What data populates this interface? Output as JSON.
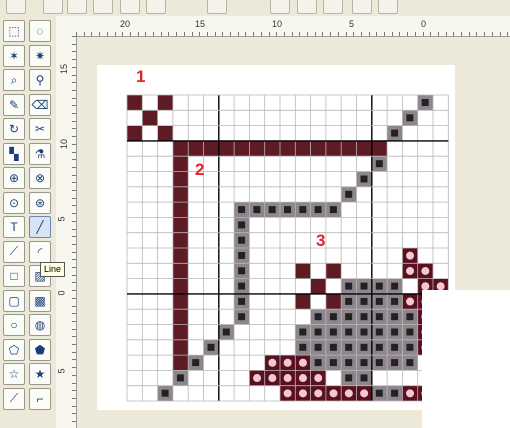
{
  "toolbar": {
    "icons": [
      "zigzag-icon",
      "new-page-icon",
      "open-icon",
      "open-folder-icon",
      "save-icon",
      "print-icon",
      "paste-special-icon",
      "cut-icon",
      "copy-icon",
      "paste-icon",
      "select-icon",
      "erase-icon"
    ]
  },
  "ruler": {
    "h_labels": [
      "20",
      "15",
      "10",
      "5",
      "0"
    ],
    "v_labels": [
      "15",
      "10",
      "5",
      "0",
      "5"
    ]
  },
  "tooltip": {
    "text": "Line"
  },
  "annotations": [
    {
      "id": "1",
      "text": "1"
    },
    {
      "id": "2",
      "text": "2"
    },
    {
      "id": "3",
      "text": "3"
    }
  ],
  "colors": {
    "maroon": "#5e1b24",
    "gray_symbol": "#8f868d",
    "grid_line": "#b7b7b7",
    "grid_bold": "#000000",
    "annotation_red": "#e0262b"
  },
  "toolbox": [
    {
      "name": "select-rect",
      "glyph": "⬚"
    },
    {
      "name": "select-lasso",
      "glyph": "◌"
    },
    {
      "name": "magic-wand",
      "glyph": "✶"
    },
    {
      "name": "magic-wand-2",
      "glyph": "✷"
    },
    {
      "name": "zoom-pattern",
      "glyph": "⌕"
    },
    {
      "name": "zoom",
      "glyph": "⚲"
    },
    {
      "name": "pencil",
      "glyph": "✎"
    },
    {
      "name": "eraser",
      "glyph": "⌫"
    },
    {
      "name": "rotate",
      "glyph": "↻"
    },
    {
      "name": "scissors",
      "glyph": "✂"
    },
    {
      "name": "bucket",
      "glyph": "▚"
    },
    {
      "name": "dropper",
      "glyph": "⚗"
    },
    {
      "name": "stamp",
      "glyph": "⊕"
    },
    {
      "name": "stamp-2",
      "glyph": "⊗"
    },
    {
      "name": "clone",
      "glyph": "⊙"
    },
    {
      "name": "clone-2",
      "glyph": "⊛"
    },
    {
      "name": "text",
      "glyph": "T"
    },
    {
      "name": "line",
      "glyph": "╱"
    },
    {
      "name": "color-picker",
      "glyph": "⟋"
    },
    {
      "name": "arc",
      "glyph": "◜"
    },
    {
      "name": "rectangle",
      "glyph": "□"
    },
    {
      "name": "filled-rectangle",
      "glyph": "▨"
    },
    {
      "name": "rounded-rect",
      "glyph": "▢"
    },
    {
      "name": "filled-rounded-rect",
      "glyph": "▩"
    },
    {
      "name": "ellipse",
      "glyph": "○"
    },
    {
      "name": "filled-ellipse",
      "glyph": "◍"
    },
    {
      "name": "polygon",
      "glyph": "⬠"
    },
    {
      "name": "filled-polygon",
      "glyph": "⬟"
    },
    {
      "name": "star",
      "glyph": "☆"
    },
    {
      "name": "filled-star",
      "glyph": "★"
    },
    {
      "name": "diagonal",
      "glyph": "⟋"
    },
    {
      "name": "steps",
      "glyph": "⌐"
    }
  ]
}
